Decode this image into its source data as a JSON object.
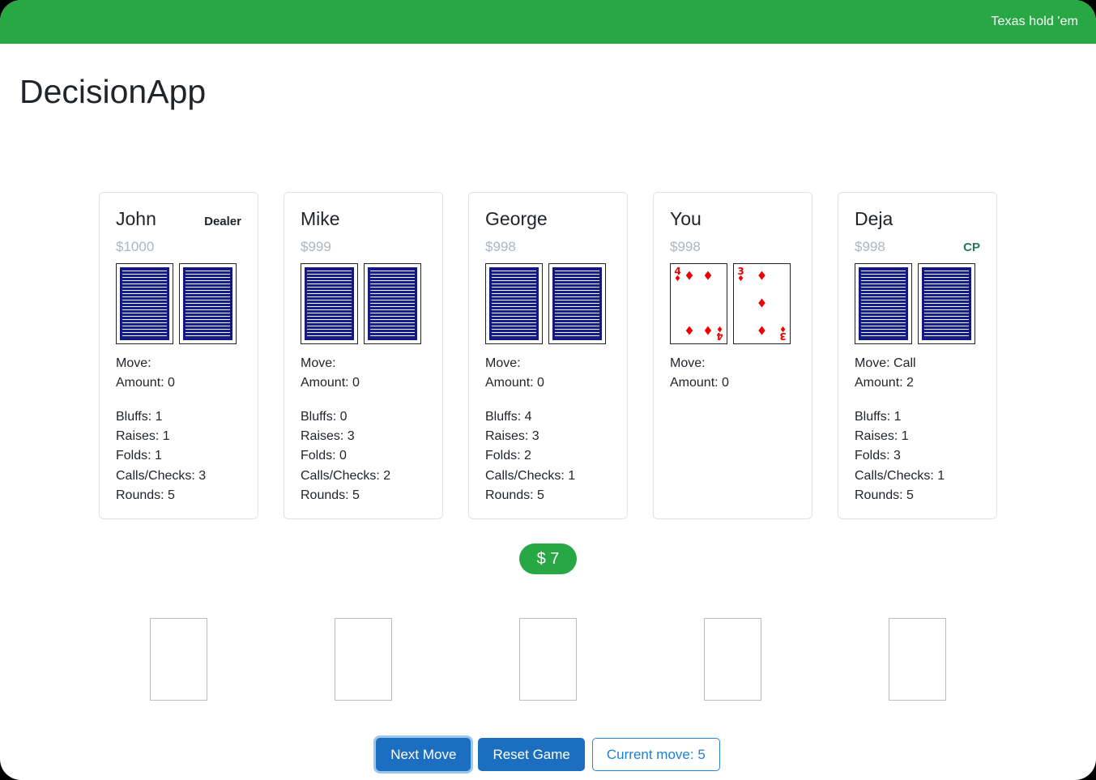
{
  "navbar": {
    "brand": "Texas hold 'em",
    "bg": "#28a745"
  },
  "app": {
    "title": "DecisionApp"
  },
  "labels": {
    "move_prefix": "Move:",
    "amount_prefix": "Amount:",
    "bluffs_prefix": "Bluffs:",
    "raises_prefix": "Raises:",
    "folds_prefix": "Folds:",
    "calls_prefix": "Calls/Checks:",
    "rounds_prefix": "Rounds:",
    "dealer_tag": "Dealer",
    "cp_tag": "CP"
  },
  "players": [
    {
      "name": "John",
      "stack": "$1000",
      "badge": "Dealer",
      "badge_type": "dealer",
      "cards": [
        {
          "face_up": false
        },
        {
          "face_up": false
        }
      ],
      "move": "Move:",
      "amount": "Amount: 0",
      "stats": {
        "bluffs": "Bluffs: 1",
        "raises": "Raises: 1",
        "folds": "Folds: 1",
        "calls": "Calls/Checks: 3",
        "rounds": "Rounds: 5"
      }
    },
    {
      "name": "Mike",
      "stack": "$999",
      "badge": "",
      "badge_type": "",
      "cards": [
        {
          "face_up": false
        },
        {
          "face_up": false
        }
      ],
      "move": "Move:",
      "amount": "Amount: 0",
      "stats": {
        "bluffs": "Bluffs: 0",
        "raises": "Raises: 3",
        "folds": "Folds: 0",
        "calls": "Calls/Checks: 2",
        "rounds": "Rounds: 5"
      }
    },
    {
      "name": "George",
      "stack": "$998",
      "badge": "",
      "badge_type": "",
      "cards": [
        {
          "face_up": false
        },
        {
          "face_up": false
        }
      ],
      "move": "Move:",
      "amount": "Amount: 0",
      "stats": {
        "bluffs": "Bluffs: 4",
        "raises": "Raises: 3",
        "folds": "Folds: 2",
        "calls": "Calls/Checks: 1",
        "rounds": "Rounds: 5"
      }
    },
    {
      "name": "You",
      "stack": "$998",
      "badge": "",
      "badge_type": "",
      "cards": [
        {
          "face_up": true,
          "rank": "4",
          "suit": "♦",
          "suit_name": "diamonds",
          "color": "#ee0000"
        },
        {
          "face_up": true,
          "rank": "3",
          "suit": "♦",
          "suit_name": "diamonds",
          "color": "#ee0000"
        }
      ],
      "move": "Move:",
      "amount": "Amount: 0",
      "stats": null
    },
    {
      "name": "Deja",
      "stack": "$998",
      "badge": "CP",
      "badge_type": "cp",
      "cards": [
        {
          "face_up": false
        },
        {
          "face_up": false
        }
      ],
      "move": "Move: Call",
      "amount": "Amount: 2",
      "stats": {
        "bluffs": "Bluffs: 1",
        "raises": "Raises: 1",
        "folds": "Folds: 3",
        "calls": "Calls/Checks: 1",
        "rounds": "Rounds: 5"
      }
    }
  ],
  "pot": {
    "label": "$ 7"
  },
  "community": {
    "slot_count": 5,
    "cards": [
      "",
      "",
      "",
      "",
      ""
    ]
  },
  "controls": {
    "next_move": "Next Move",
    "reset_game": "Reset Game",
    "current_move": "Current move: 5"
  },
  "colors": {
    "brand_green": "#28a745",
    "cp_green": "#1e7e52",
    "primary_blue": "#1c6fc0",
    "outline_blue": "#2a85d8",
    "card_back_navy": "#181e8a",
    "suit_red": "#ee0000"
  }
}
